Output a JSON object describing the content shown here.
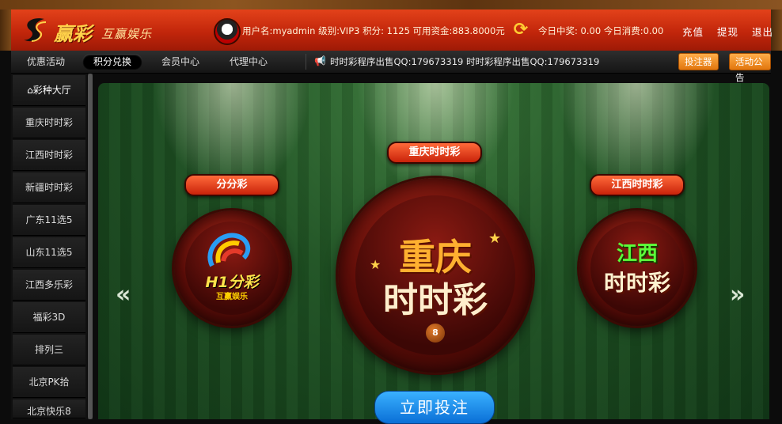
{
  "brand": {
    "name": "赢彩",
    "sub": "互赢娱乐"
  },
  "user": {
    "info": "用户名:myadmin 级别:VIP3 积分: 1125 可用资金:883.8000元",
    "today": "今日中奖: 0.00 今日消费:0.00"
  },
  "header_links": [
    "充值",
    "提现",
    "退出"
  ],
  "nav": {
    "items": [
      "优惠活动",
      "积分兑换",
      "会员中心",
      "代理中心"
    ],
    "active": "积分兑换",
    "marquee": "时时彩程序出售QQ:179673319 时时彩程序出售QQ:179673319",
    "btn_bet": "投注器",
    "btn_notice": "活动公告"
  },
  "sidebar": {
    "home": "彩种大厅",
    "items": [
      "重庆时时彩",
      "江西时时彩",
      "新疆时时彩",
      "广东11选5",
      "山东11选5",
      "江西多乐彩",
      "福彩3D",
      "排列三",
      "北京PK拾",
      "北京快乐8"
    ]
  },
  "games": {
    "left": {
      "ribbon": "分分彩",
      "line1": "H1分彩",
      "line2": "互赢娱乐"
    },
    "center": {
      "ribbon": "重庆时时彩",
      "line1": "重庆",
      "line2": "时时彩",
      "ball_number": "8"
    },
    "right": {
      "ribbon": "江西时时彩",
      "line1": "江西",
      "line2": "时时彩"
    }
  },
  "bet_button": "立即投注",
  "arrows": {
    "prev": "«",
    "next": "»"
  },
  "colors": {
    "header_red": "#c2260b",
    "gold": "#ffd24a",
    "table_green": "#205424",
    "bet_blue": "#0a6fd6",
    "orange_btn": "#e2760d"
  }
}
